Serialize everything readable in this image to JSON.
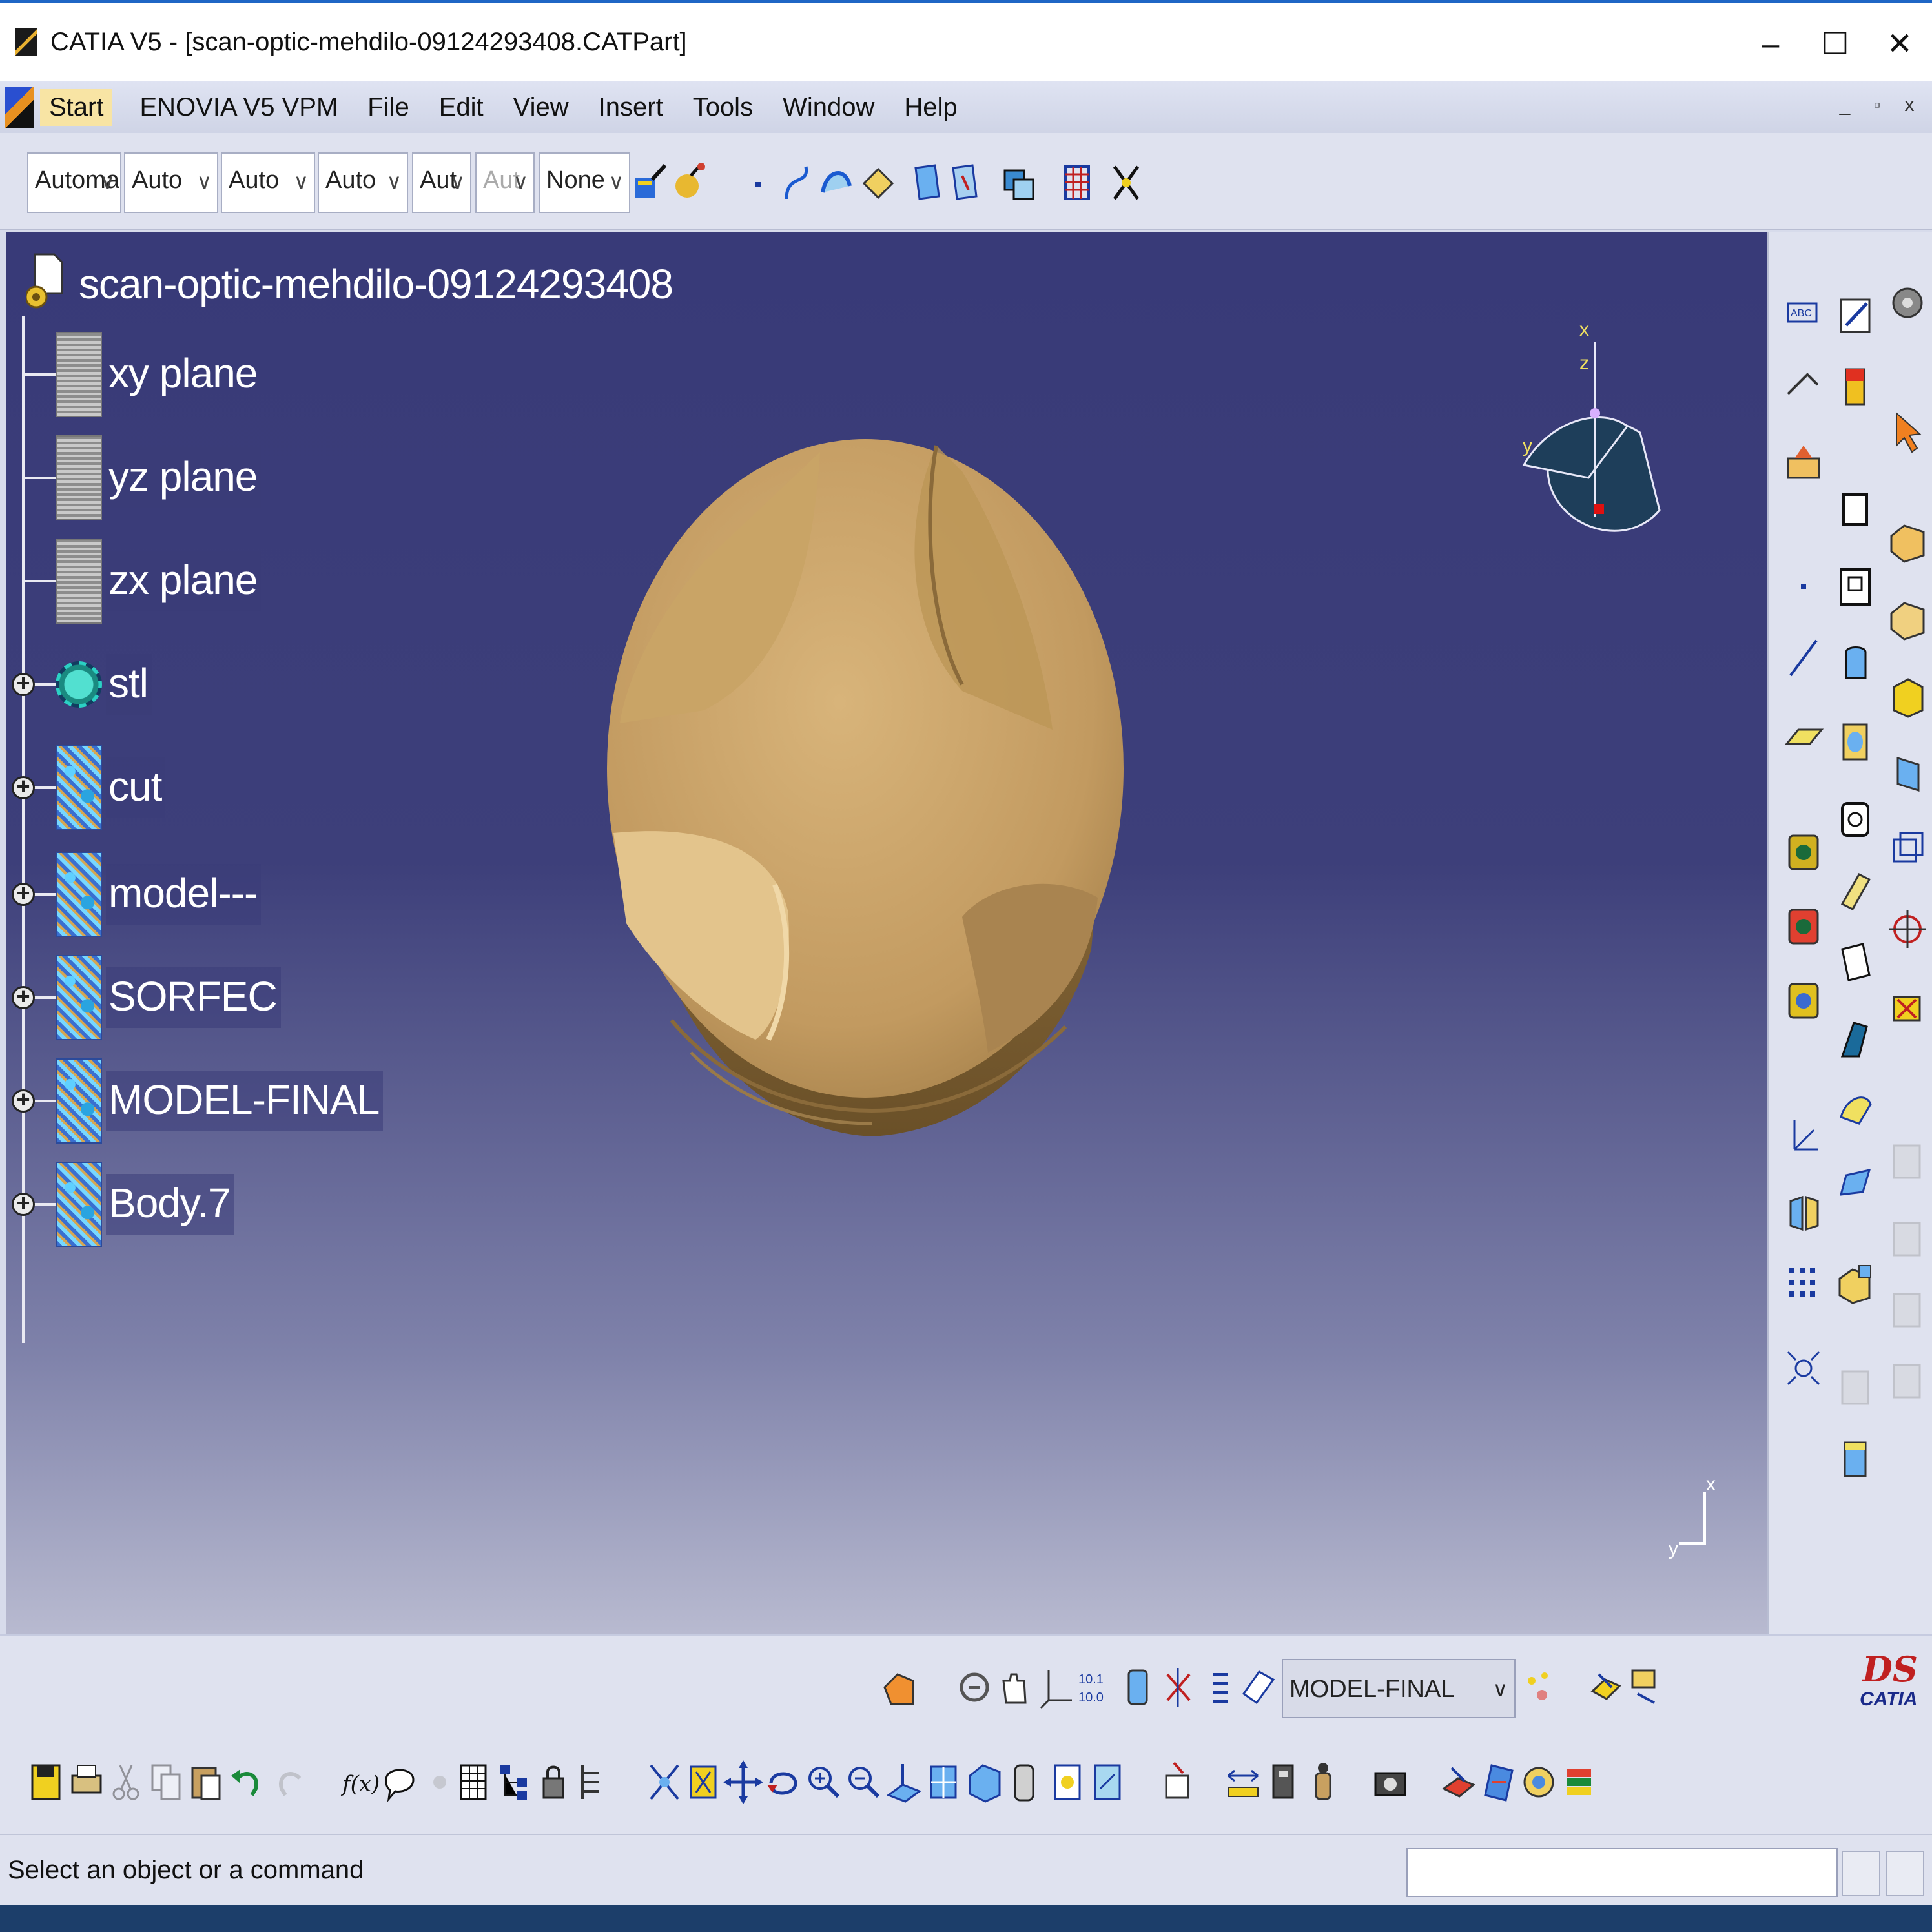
{
  "window": {
    "title": "CATIA V5 - [scan-optic-mehdilo-09124293408.CATPart]",
    "minimize": "–",
    "maximize": "☐",
    "close": "✕"
  },
  "menubar": {
    "start": "Start",
    "enovia": "ENOVIA V5 VPM",
    "file": "File",
    "edit": "Edit",
    "view": "View",
    "insert": "Insert",
    "tools": "Tools",
    "window": "Window",
    "help": "Help",
    "mdi_min": "_",
    "mdi_restore": "▫",
    "mdi_close": "x"
  },
  "graphic_properties": {
    "combos": [
      {
        "value": "Automa",
        "enabled": true
      },
      {
        "value": "Auto",
        "enabled": true
      },
      {
        "value": "Auto",
        "enabled": true
      },
      {
        "value": "Auto",
        "enabled": true
      },
      {
        "value": "Aut",
        "enabled": true
      },
      {
        "value": "Aut",
        "enabled": false
      },
      {
        "value": "None",
        "enabled": true
      }
    ]
  },
  "tree": {
    "root": "scan-optic-mehdilo-09124293408",
    "items": [
      {
        "label": "xy plane",
        "type": "plane",
        "expandable": false
      },
      {
        "label": "yz plane",
        "type": "plane",
        "expandable": false
      },
      {
        "label": "zx plane",
        "type": "plane",
        "expandable": false
      },
      {
        "label": "stl",
        "type": "stl",
        "expandable": true
      },
      {
        "label": "cut",
        "type": "body",
        "expandable": true
      },
      {
        "label": "model---",
        "type": "body",
        "expandable": true
      },
      {
        "label": "SORFEC",
        "type": "body",
        "expandable": true
      },
      {
        "label": "MODEL-FINAL",
        "type": "body",
        "expandable": true
      },
      {
        "label": "Body.7",
        "type": "body",
        "expandable": true
      }
    ]
  },
  "compass": {
    "x": "x",
    "y": "y",
    "z": "z"
  },
  "axis_triad": {
    "x": "x",
    "y": "y"
  },
  "layer": {
    "current": "MODEL-FINAL"
  },
  "brand": {
    "ds": "DS",
    "catia": "CATIA"
  },
  "status": {
    "message": "Select an object or a command"
  },
  "colors": {
    "viewport_top": "#383a78",
    "viewport_bottom": "#b8bad0",
    "part": "#c9a46a",
    "menu_highlight": "#f8e4a4"
  }
}
